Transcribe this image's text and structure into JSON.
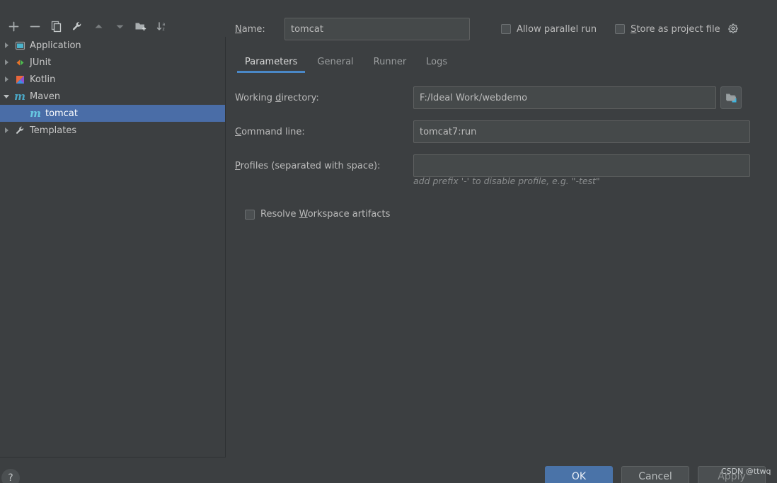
{
  "dialog": {
    "help_label": "?",
    "watermark": "CSDN @ttwq"
  },
  "toolbar": {
    "items": [
      {
        "icon": "plus-icon",
        "tooltip": "Add New Configuration"
      },
      {
        "icon": "minus-icon",
        "tooltip": "Remove Configuration"
      },
      {
        "icon": "copy-icon",
        "tooltip": "Copy Configuration"
      },
      {
        "icon": "wrench-icon",
        "tooltip": "Edit Templates"
      },
      {
        "icon": "arrow-up-icon",
        "tooltip": "Move Up"
      },
      {
        "icon": "arrow-down-icon",
        "tooltip": "Move Down"
      },
      {
        "icon": "folder-add-icon",
        "tooltip": "Create New Folder"
      },
      {
        "icon": "sort-alphabetically-icon",
        "tooltip": "Sort Configurations"
      }
    ]
  },
  "tree": {
    "items": [
      {
        "label": "Application",
        "icon": "application-icon",
        "expandable": true,
        "expanded": false,
        "selected": false,
        "depth": 0
      },
      {
        "label": "JUnit",
        "icon": "junit-icon",
        "expandable": true,
        "expanded": false,
        "selected": false,
        "depth": 0
      },
      {
        "label": "Kotlin",
        "icon": "kotlin-icon",
        "expandable": true,
        "expanded": false,
        "selected": false,
        "depth": 0
      },
      {
        "label": "Maven",
        "icon": "maven-icon",
        "expandable": true,
        "expanded": true,
        "selected": false,
        "depth": 0
      },
      {
        "label": "tomcat",
        "icon": "maven-icon",
        "expandable": false,
        "expanded": false,
        "selected": true,
        "depth": 1
      },
      {
        "label": "Templates",
        "icon": "wrench-icon",
        "expandable": true,
        "expanded": false,
        "selected": false,
        "depth": 0
      }
    ]
  },
  "form": {
    "name_label": "Name:",
    "name_mnemonic": "N",
    "name_value": "tomcat",
    "allow_parallel_run": {
      "label": "Allow parallel run",
      "checked": false
    },
    "store_as_project_file": {
      "label": "Store as project file",
      "checked": false,
      "gear_icon": "gear-icon"
    }
  },
  "tabs": [
    {
      "label": "Parameters",
      "active": true
    },
    {
      "label": "General",
      "active": false
    },
    {
      "label": "Runner",
      "active": false
    },
    {
      "label": "Logs",
      "active": false
    }
  ],
  "parameters": {
    "working_directory": {
      "label": "Working directory:",
      "mnemonic": "d",
      "value": "F:/Ideal Work/webdemo",
      "browse_icon": "folder-open-icon",
      "module_icon": "module-folder-icon"
    },
    "command_line": {
      "label": "Command line:",
      "mnemonic": "C",
      "value": "tomcat7:run",
      "placeholder": ""
    },
    "profiles": {
      "label": "Profiles (separated with space):",
      "mnemonic": "P",
      "value": "",
      "placeholder": ""
    },
    "profiles_hint": "add prefix '-' to disable profile, e.g. \"-test\"",
    "resolve_workspace_artifacts": {
      "label": "Resolve Workspace artifacts",
      "mnemonic": "W",
      "checked": false
    }
  },
  "buttons": {
    "ok": "OK",
    "cancel": "Cancel",
    "apply": "Apply"
  },
  "colors": {
    "background": "#3c3f41",
    "field_background": "#45494a",
    "selection_blue": "#4a6da7",
    "accent_blue": "#4a88c7",
    "primary_button": "#4a73a8",
    "text": "#bbbbbb",
    "maven_icon": "#4ba6c4"
  }
}
